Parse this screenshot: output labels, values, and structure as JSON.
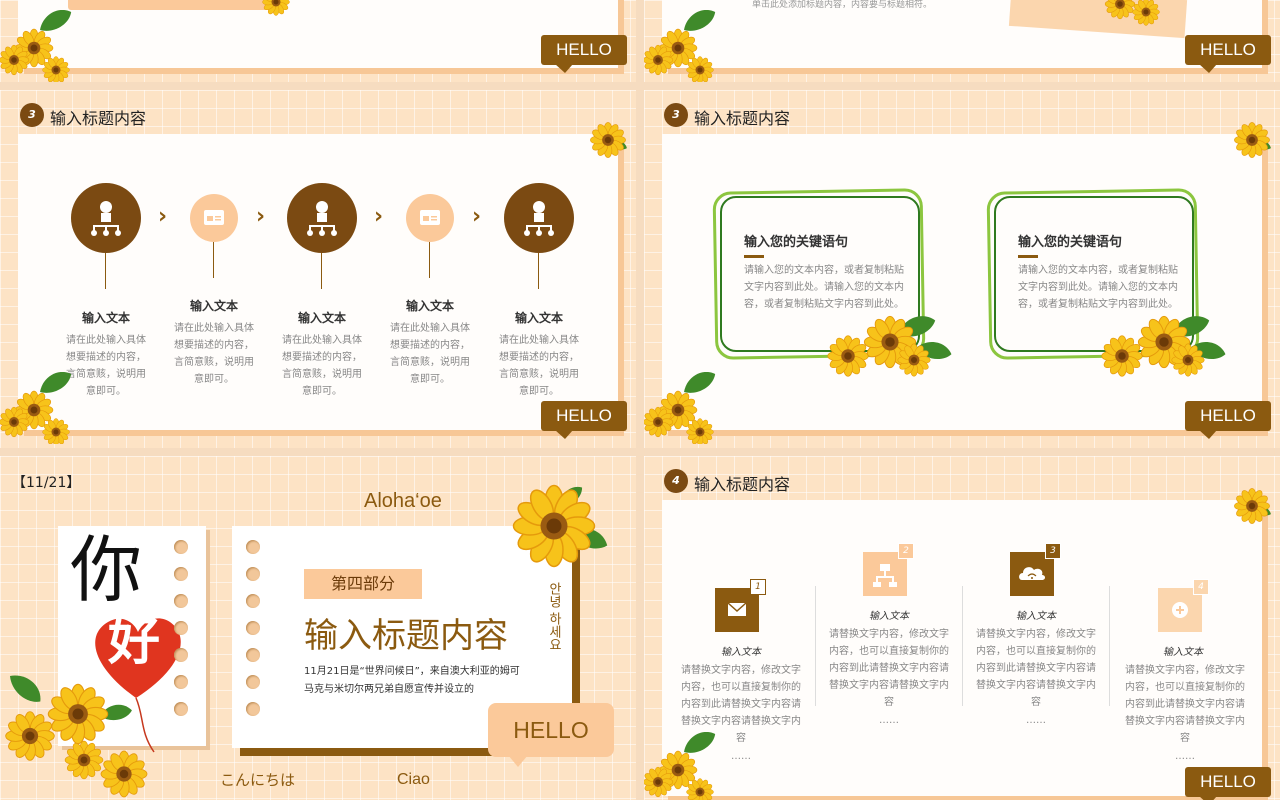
{
  "hello": "HELLO",
  "top_right": {
    "subtitle": "单击此处添加标题内容，内容要与标题相符。"
  },
  "slide_mid_left": {
    "number": "3",
    "title": "输入标题内容",
    "steps": [
      {
        "label": "输入文本",
        "body": "请在此处输入具体想要描述的内容，言简意赅，说明用意即可。"
      },
      {
        "label": "输入文本",
        "body": "请在此处输入具体想要描述的内容，言简意赅，说明用意即可。"
      },
      {
        "label": "输入文本",
        "body": "请在此处输入具体想要描述的内容，言简意赅，说明用意即可。"
      },
      {
        "label": "输入文本",
        "body": "请在此处输入具体想要描述的内容，言简意赅，说明用意即可。"
      },
      {
        "label": "输入文本",
        "body": "请在此处输入具体想要描述的内容，言简意赅，说明用意即可。"
      }
    ]
  },
  "slide_mid_right": {
    "number": "3",
    "title": "输入标题内容",
    "boxes": [
      {
        "heading": "输入您的关键语句",
        "body": "请输入您的文本内容，或者复制粘贴文字内容到此处。请输入您的文本内容，或者复制粘贴文字内容到此处。"
      },
      {
        "heading": "输入您的关键语句",
        "body": "请输入您的文本内容，或者复制粘贴文字内容到此处。请输入您的文本内容，或者复制粘贴文字内容到此处。"
      }
    ]
  },
  "slide_bottom_left": {
    "counter": "【11/21】",
    "aloha": "Aloha‘oe",
    "ni": "你",
    "hao": "好",
    "part": "第四部分",
    "title": "输入标题内容",
    "korean": "안녕 하세요",
    "desc_line1": "11月21日是“世界问候日”，来自澳大利亚的姆可",
    "desc_line2": "马克与米切尔两兄弟自愿宣传并设立的",
    "hello_bubble": "HELLO",
    "konnichiwa": "こんにちは",
    "ciao": "Ciao"
  },
  "slide_bottom_right": {
    "number": "4",
    "title": "输入标题内容",
    "items": [
      {
        "badge": "1",
        "label": "输入文本",
        "body": "请替换文字内容，修改文字内容，也可以直接复制你的内容到此请替换文字内容请替换文字内容请替换文字内容",
        "more": "……"
      },
      {
        "badge": "2",
        "label": "输入文本",
        "body": "请替换文字内容，修改文字内容，也可以直接复制你的内容到此请替换文字内容请替换文字内容请替换文字内容",
        "more": "……"
      },
      {
        "badge": "3",
        "label": "输入文本",
        "body": "请替换文字内容，修改文字内容，也可以直接复制你的内容到此请替换文字内容请替换文字内容请替换文字内容",
        "more": "……"
      },
      {
        "badge": "4",
        "label": "输入文本",
        "body": "请替换文字内容，修改文字内容，也可以直接复制你的内容到此请替换文字内容请替换文字内容请替换文字内容",
        "more": "……"
      }
    ]
  },
  "colors": {
    "brown": "#8b5a10",
    "peach": "#fbc99a",
    "green": "#6cab2a"
  }
}
